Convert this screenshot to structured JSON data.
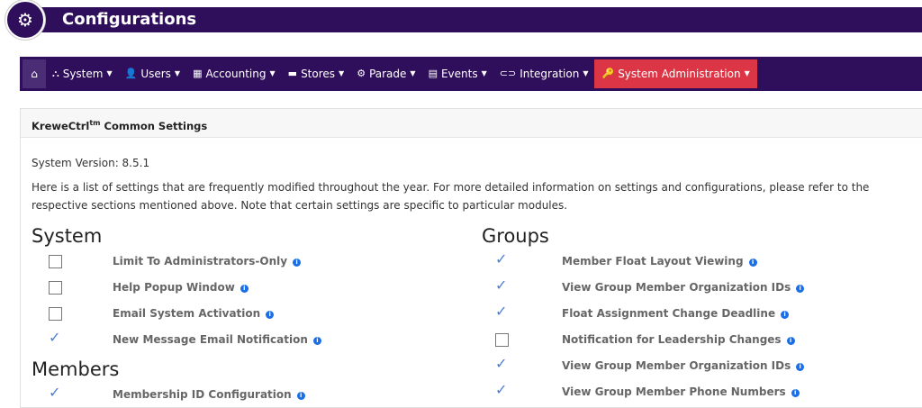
{
  "header": {
    "title": "Configurations"
  },
  "nav": {
    "items": [
      {
        "label": "System",
        "icon": "sitemap-icon",
        "glyph": "⛬"
      },
      {
        "label": "Users",
        "icon": "user-icon",
        "glyph": "👤"
      },
      {
        "label": "Accounting",
        "icon": "calculator-icon",
        "glyph": "▦"
      },
      {
        "label": "Stores",
        "icon": "store-icon",
        "glyph": "▬"
      },
      {
        "label": "Parade",
        "icon": "float-icon",
        "glyph": "⚙"
      },
      {
        "label": "Events",
        "icon": "calendar-icon",
        "glyph": "▤"
      },
      {
        "label": "Integration",
        "icon": "link-icon",
        "glyph": "⊂⊃"
      },
      {
        "label": "System Administration",
        "icon": "key-icon",
        "glyph": "🔑"
      }
    ]
  },
  "card": {
    "title": "KreweCtrl",
    "title_sup": "tm",
    "title_rest": " Common Settings",
    "version": "System Version: 8.5.1",
    "description": "Here is a list of settings that are frequently modified throughout the year. For more detailed information on settings and configurations, please refer to the respective sections mentioned above. Note that certain settings are specific to particular modules."
  },
  "system": {
    "heading": "System",
    "settings": [
      {
        "label": "Limit To Administrators-Only",
        "checked": false
      },
      {
        "label": "Help Popup Window",
        "checked": false
      },
      {
        "label": "Email System Activation",
        "checked": false
      },
      {
        "label": "New Message Email Notification",
        "checked": true
      }
    ]
  },
  "members": {
    "heading": "Members",
    "settings": [
      {
        "label": "Membership ID Configuration",
        "checked": true
      }
    ]
  },
  "groups": {
    "heading": "Groups",
    "settings": [
      {
        "label": "Member Float Layout Viewing",
        "checked": true
      },
      {
        "label": "View Group Member Organization IDs",
        "checked": true
      },
      {
        "label": "Float Assignment Change Deadline",
        "checked": true
      },
      {
        "label": "Notification for Leadership Changes",
        "checked": false
      },
      {
        "label": "View Group Member Organization IDs",
        "checked": true
      },
      {
        "label": "View Group Member Phone Numbers",
        "checked": true
      }
    ]
  }
}
